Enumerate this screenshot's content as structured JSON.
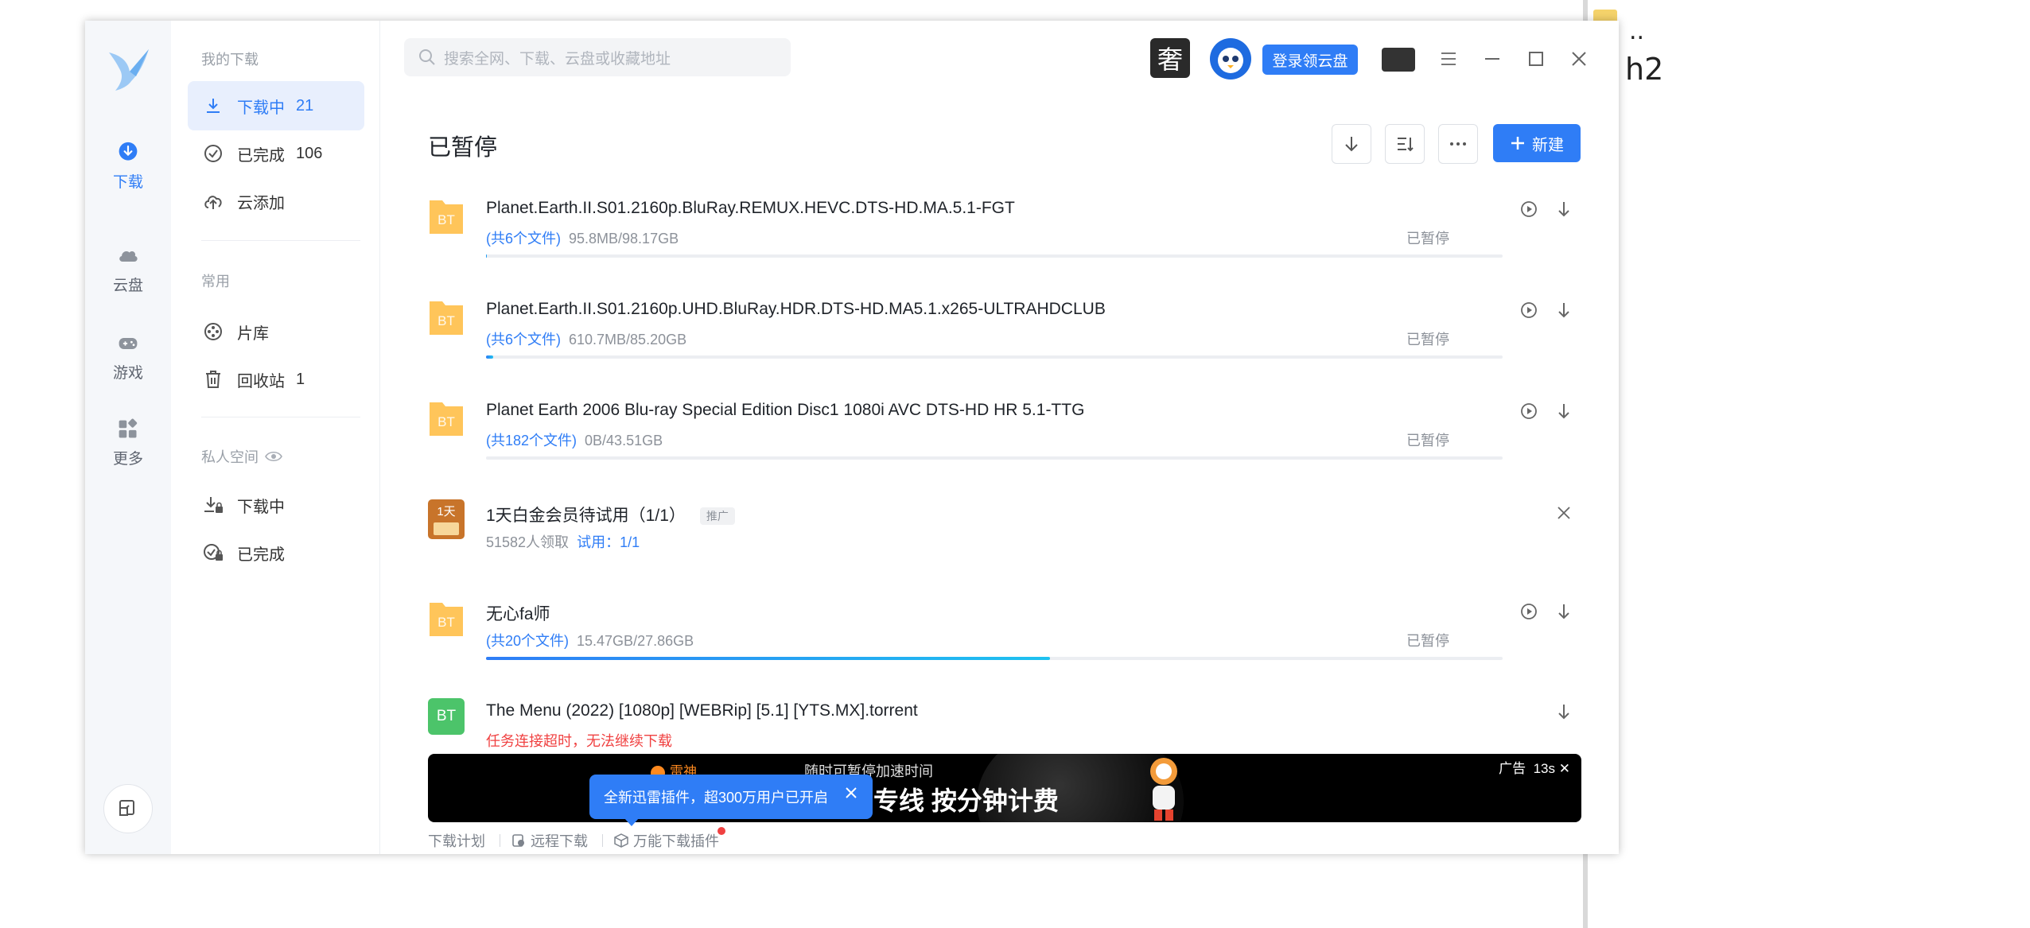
{
  "background": {
    "dots": "..",
    "text": "h2"
  },
  "rail": {
    "items": [
      {
        "label": "下载",
        "icon": "download-circle-icon"
      },
      {
        "label": "云盘",
        "icon": "cloud-icon"
      },
      {
        "label": "游戏",
        "icon": "gamepad-icon"
      },
      {
        "label": "更多",
        "icon": "apps-icon"
      }
    ]
  },
  "subnav": {
    "my_downloads_title": "我的下载",
    "downloading_label": "下载中",
    "downloading_count": "21",
    "completed_label": "已完成",
    "completed_count": "106",
    "cloud_add_label": "云添加",
    "common_title": "常用",
    "library_label": "片库",
    "recycle_label": "回收站",
    "recycle_count": "1",
    "private_title": "私人空间",
    "private_downloading_label": "下载中",
    "private_completed_label": "已完成"
  },
  "header": {
    "search_placeholder": "搜索全网、下载、云盘或收藏地址",
    "login_button": "登录领云盘",
    "avatar_glyph": "奢"
  },
  "main": {
    "title": "已暂停",
    "new_button": "新建"
  },
  "tasks": [
    {
      "name": "Planet.Earth.II.S01.2160p.BluRay.REMUX.HEVC.DTS-HD.MA.5.1-FGT",
      "files": "(共6个文件)",
      "size": "95.8MB/98.17GB",
      "status": "已暂停",
      "progress": 0.001,
      "icon_label": "BT"
    },
    {
      "name": "Planet.Earth.II.S01.2160p.UHD.BluRay.HDR.DTS-HD.MA5.1.x265-ULTRAHDCLUB",
      "files": "(共6个文件)",
      "size": "610.7MB/85.20GB",
      "status": "已暂停",
      "progress": 0.007,
      "icon_label": "BT"
    },
    {
      "name": "Planet Earth 2006 Blu-ray Special Edition Disc1 1080i AVC DTS-HD HR 5.1-TTG",
      "files": "(共182个文件)",
      "size": "0B/43.51GB",
      "status": "已暂停",
      "progress": 0,
      "icon_label": "BT"
    },
    {
      "name": "无心fa师",
      "files": "(共20个文件)",
      "size": "15.47GB/27.86GB",
      "status": "已暂停",
      "progress": 0.555,
      "icon_label": "BT"
    },
    {
      "name": "The Menu (2022) [1080p] [WEBRip] [5.1] [YTS.MX].torrent",
      "error": "任务连接超时，无法继续下载",
      "icon_label": "BT"
    }
  ],
  "promo": {
    "name": "1天白金会员待试用（1/1）",
    "tag": "推广",
    "meta": "51582人领取",
    "trial": "试用：1/1",
    "icon_text": "1天"
  },
  "ad": {
    "line1": "随时可暂停加速时间",
    "line2": "专线  按分钟计费",
    "label": "广告",
    "countdown": "13s",
    "brand": "雷神"
  },
  "tooltip": {
    "text": "全新迅雷插件，超300万用户已开启"
  },
  "footer": {
    "plan": "下载计划",
    "remote": "远程下载",
    "plugin": "万能下载插件"
  },
  "colors": {
    "accent": "#2f7df6",
    "error": "#f04141",
    "folder": "#ffc55a",
    "bt_green": "#4cc46a"
  }
}
